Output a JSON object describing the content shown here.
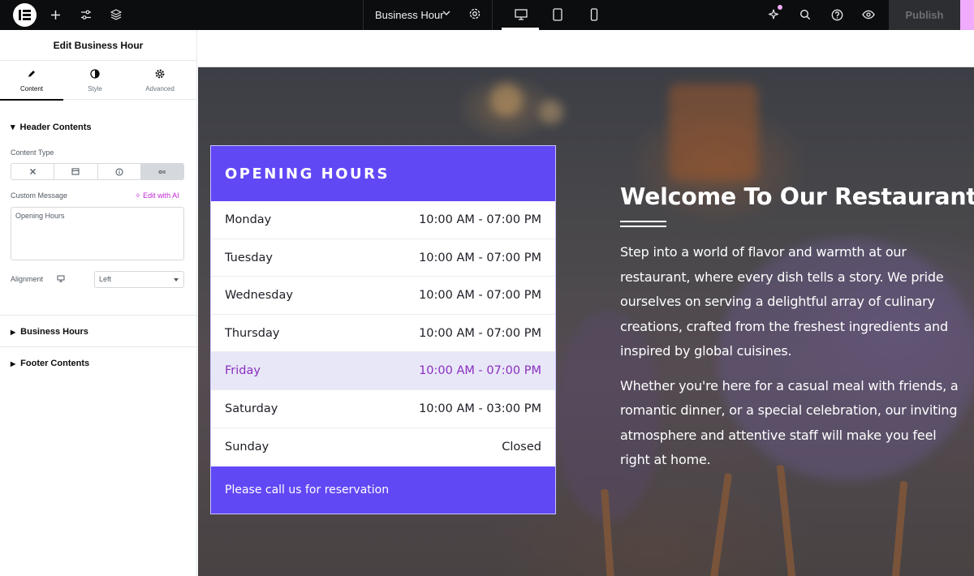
{
  "topbar": {
    "document_title": "Business Hour",
    "publish_label": "Publish",
    "colors": {
      "bar": "#0c0d0e",
      "accent": "#f0abfc"
    }
  },
  "panel": {
    "title": "Edit Business Hour",
    "tabs": [
      {
        "label": "Content",
        "icon": "pencil-icon",
        "active": true
      },
      {
        "label": "Style",
        "icon": "half-circle-icon",
        "active": false
      },
      {
        "label": "Advanced",
        "icon": "gear-icon",
        "active": false
      }
    ],
    "header_section": "Header Contents",
    "content_type_label": "Content Type",
    "content_type_options": [
      "none-icon",
      "template-icon",
      "info-icon",
      "ai-message-icon"
    ],
    "custom_message_label": "Custom Message",
    "edit_with_ai": "Edit with AI",
    "custom_message_value": "Opening Hours",
    "alignment_label": "Alignment",
    "alignment_value": "Left",
    "sections": [
      "Business Hours",
      "Footer Contents"
    ]
  },
  "widget": {
    "title": "OPENING HOURS",
    "rows": [
      {
        "day": "Monday",
        "time": "10:00 AM - 07:00 PM"
      },
      {
        "day": "Tuesday",
        "time": "10:00 AM - 07:00 PM"
      },
      {
        "day": "Wednesday",
        "time": "10:00 AM - 07:00 PM"
      },
      {
        "day": "Thursday",
        "time": "10:00 AM - 07:00 PM"
      },
      {
        "day": "Friday",
        "time": "10:00 AM - 07:00 PM",
        "highlight": true
      },
      {
        "day": "Saturday",
        "time": "10:00 AM - 03:00 PM"
      },
      {
        "day": "Sunday",
        "time": "Closed"
      }
    ],
    "footer": "Please call us for reservation",
    "colors": {
      "header": "#6148f5",
      "highlight_bg": "#e8e7f8",
      "highlight_text": "#8a2fbf"
    }
  },
  "welcome": {
    "heading": "Welcome To Our Restaurant",
    "paragraph1": "Step into a world of flavor and warmth at our restaurant, where every dish tells a story. We pride ourselves on serving a delightful array of culinary creations, crafted from the freshest ingredients and inspired by global cuisines.",
    "paragraph2": "Whether you're here for a casual meal with friends, a romantic dinner, or a special celebration, our inviting atmosphere and attentive staff will make you feel right at home."
  }
}
